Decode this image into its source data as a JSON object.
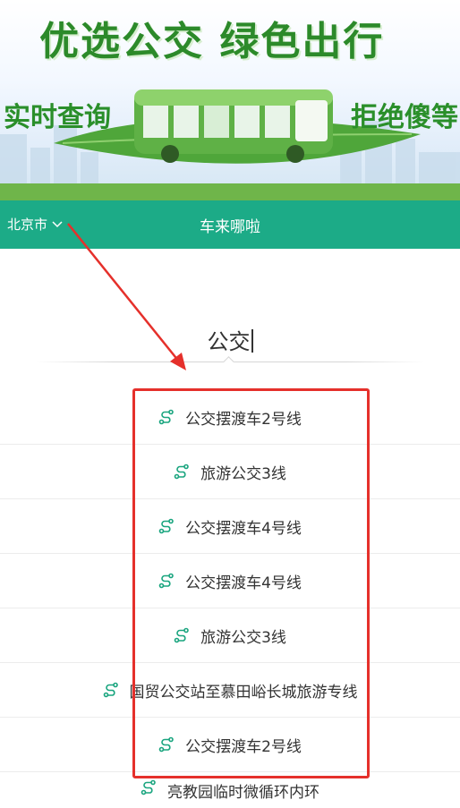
{
  "banner": {
    "slogan_main": "优选公交  绿色出行",
    "slogan_left": "实时查询",
    "slogan_right": "拒绝傻等"
  },
  "header": {
    "city": "北京市",
    "title": "车来哪啦",
    "background_color": "#1cab87"
  },
  "search": {
    "query": "公交"
  },
  "results": [
    {
      "label": "公交摆渡车2号线",
      "icon": "route-icon"
    },
    {
      "label": "旅游公交3线",
      "icon": "route-icon"
    },
    {
      "label": "公交摆渡车4号线",
      "icon": "route-icon"
    },
    {
      "label": "公交摆渡车4号线",
      "icon": "route-icon"
    },
    {
      "label": "旅游公交3线",
      "icon": "route-icon"
    },
    {
      "label": "国贸公交站至慕田峪长城旅游专线",
      "icon": "route-icon"
    },
    {
      "label": "公交摆渡车2号线",
      "icon": "route-icon"
    },
    {
      "label": "亮教园临时微循环内环",
      "icon": "route-icon"
    }
  ],
  "colors": {
    "accent": "#1cab87",
    "annotation_red": "#e5302b",
    "icon_green": "#1aa57f"
  }
}
